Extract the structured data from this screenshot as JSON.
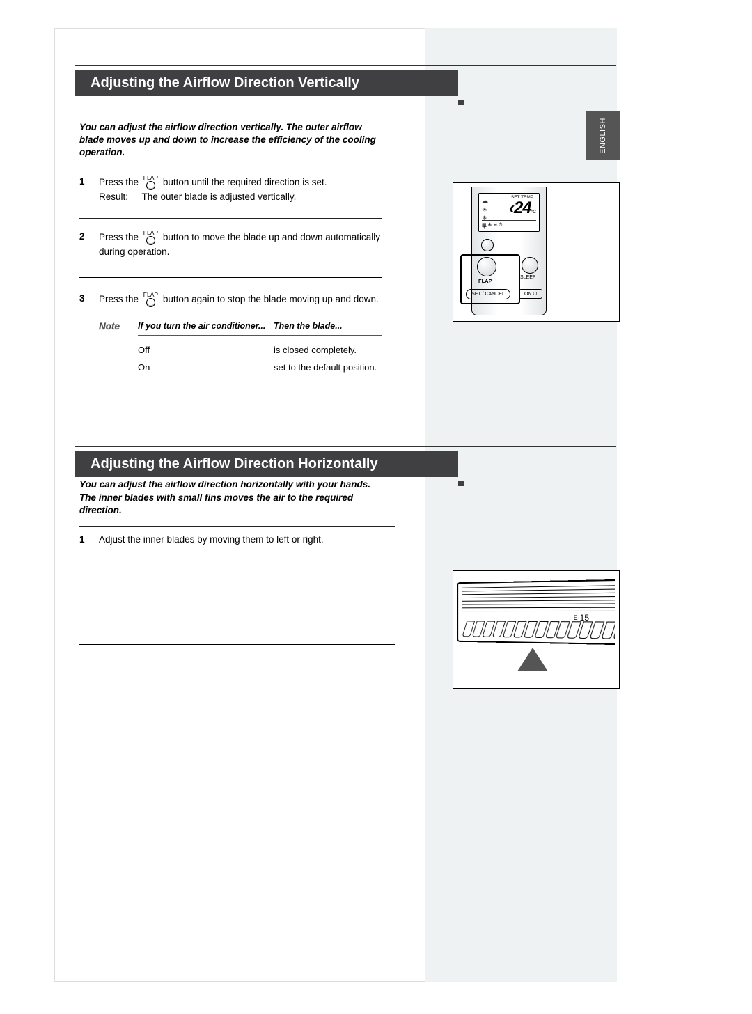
{
  "language_tab": "ENGLISH",
  "section1": {
    "title": "Adjusting the Airflow Direction Vertically",
    "intro": "You can adjust the airflow direction vertically. The outer airflow blade moves up and down to increase the efficiency of the cooling operation.",
    "flap_label": "FLAP",
    "steps": [
      {
        "num": "1",
        "pre": "Press the ",
        "post": " button until the required direction is set.",
        "result_label": "Result:",
        "result_text": "The outer blade is adjusted vertically."
      },
      {
        "num": "2",
        "pre": "Press the ",
        "post": " button to move the blade up and down automatically during operation."
      },
      {
        "num": "3",
        "pre": "Press the ",
        "post": " button again to stop the blade moving up and down."
      }
    ],
    "note": {
      "label": "Note",
      "head_if": "If you turn the air conditioner...",
      "head_then": "Then the blade...",
      "rows": [
        {
          "if": "Off",
          "then": "is closed completely."
        },
        {
          "if": "On",
          "then": "set to the default position."
        }
      ]
    }
  },
  "section2": {
    "title": "Adjusting the Airflow Direction Horizontally",
    "intro_l1": "You can adjust the airflow direction horizontally with your hands.",
    "intro_l2": "The inner blades with small fins moves the air to the required direction.",
    "steps": [
      {
        "num": "1",
        "text": "Adjust the inner blades by moving them to left or right."
      }
    ]
  },
  "remote": {
    "set_temp_label": "SET TEMP.",
    "set_temp_value": "24",
    "set_temp_unit": "°C",
    "flap": "FLAP",
    "sleep": "SLEEP",
    "set_cancel": "SET / CANCEL",
    "on": "ON ⏻"
  },
  "page_number": {
    "prefix": "E-",
    "num": "15"
  }
}
